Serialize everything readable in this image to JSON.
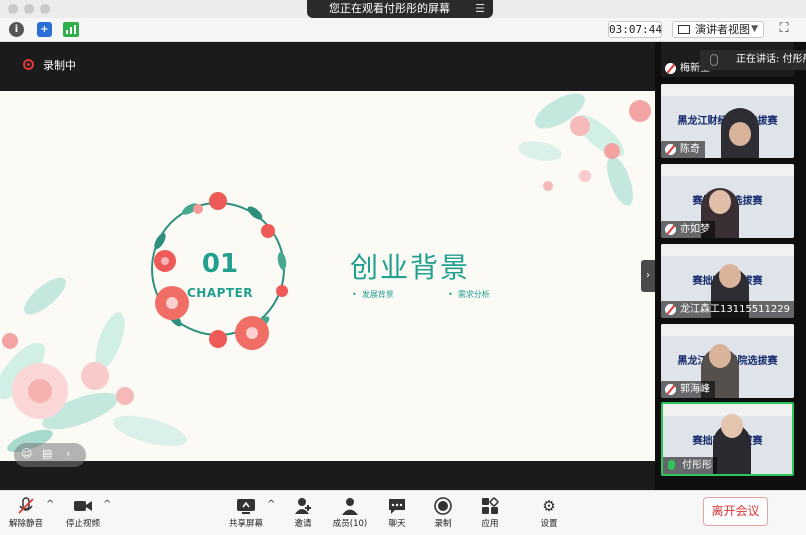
{
  "share_banner": {
    "text": "您正在观看付彤彤的屏幕",
    "menu_icon": "menu-lines-icon"
  },
  "toolbar": {
    "timer": "03:07:44",
    "view_label": "演讲者视图",
    "info_icon": "info-icon",
    "security_icon": "shield-icon",
    "signal_icon": "signal-bars-icon",
    "fullscreen_icon": "fullscreen-icon"
  },
  "recording": {
    "label": "录制中",
    "color": "#e03a3a"
  },
  "slide": {
    "number": "01",
    "chapter": "CHAPTER",
    "title": "创业背景",
    "bullets": [
      "发展背景",
      "需求分析"
    ],
    "accent": "#21a090"
  },
  "speaking": {
    "label": "正在讲话: 付彤彤"
  },
  "participants": [
    {
      "name": "梅新星",
      "banner": "",
      "muted": true
    },
    {
      "name": "陈奇",
      "banner": "黑龙江财经学院选拔赛",
      "muted": true
    },
    {
      "name": "亦如梦",
      "banner": "赛拙赛区选拔赛",
      "muted": true
    },
    {
      "name": "龙江森工13115511229",
      "banner": "赛拙赛区选拔赛",
      "muted": true
    },
    {
      "name": "郭海峰",
      "banner": "黑龙江财经学院选拔赛",
      "muted": true
    },
    {
      "name": "付彤彤",
      "banner": "赛拙赛区选拔赛",
      "muted": false
    }
  ],
  "bottombar": {
    "items": [
      {
        "label": "解除静音",
        "icon": "mic-off-icon"
      },
      {
        "label": "停止视频",
        "icon": "video-icon"
      },
      {
        "label": "共享屏幕",
        "icon": "share-screen-icon"
      },
      {
        "label": "邀请",
        "icon": "invite-icon"
      },
      {
        "label": "成员(10)",
        "icon": "members-icon"
      },
      {
        "label": "聊天",
        "icon": "chat-icon"
      },
      {
        "label": "录制",
        "icon": "record-icon"
      },
      {
        "label": "应用",
        "icon": "apps-icon"
      },
      {
        "label": "设置",
        "icon": "gear-icon"
      }
    ],
    "leave_label": "离开会议"
  }
}
